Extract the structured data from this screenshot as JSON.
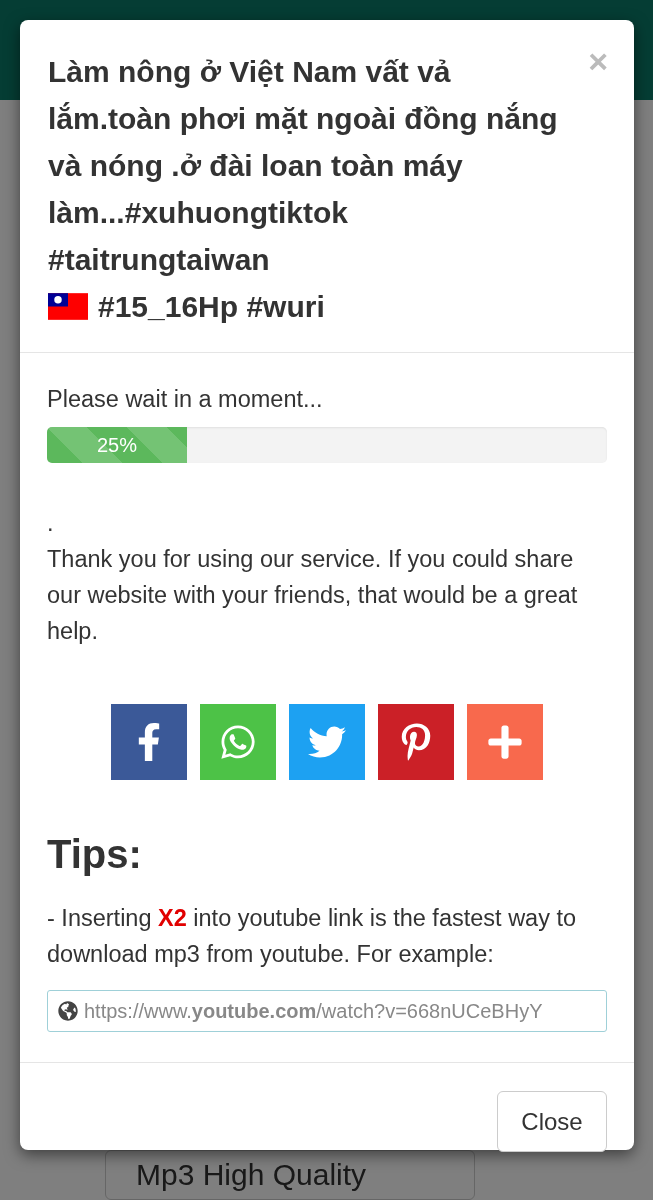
{
  "background": {
    "select_text": "Mp3 High Quality"
  },
  "modal": {
    "title_before_flag": "Làm nông ở Việt Nam vất vả lắm.toàn phơi mặt ngoài đồng nắng và nóng .ở đài loan toàn máy làm...#xuhuongtiktok #taitrungtaiwan",
    "title_after_flag": "#15_16Hp #wuri",
    "close_symbol": "×",
    "wait_text": "Please wait in a moment...",
    "progress": {
      "level": 0.25,
      "label": "25%"
    },
    "dot_text": ".",
    "thanks_text": "Thank you for using our service. If you could share our website with your friends, that would be a great help.",
    "share_buttons": [
      {
        "kind": "facebook",
        "color": "#3b5998"
      },
      {
        "kind": "whatsapp",
        "color": "#4dc247"
      },
      {
        "kind": "twitter",
        "color": "#1da1f2"
      },
      {
        "kind": "pinterest",
        "color": "#cb2027"
      },
      {
        "kind": "more",
        "color": "#f8694d"
      }
    ],
    "tips_heading": "Tips:",
    "tip_text": "- Inserting **X2** into youtube link is the fastest way to download mp3 from youtube. For example:",
    "example_url": "https://www.**youtube.com**/watch?v=668nUCeBHyY",
    "close_button": "Close"
  }
}
